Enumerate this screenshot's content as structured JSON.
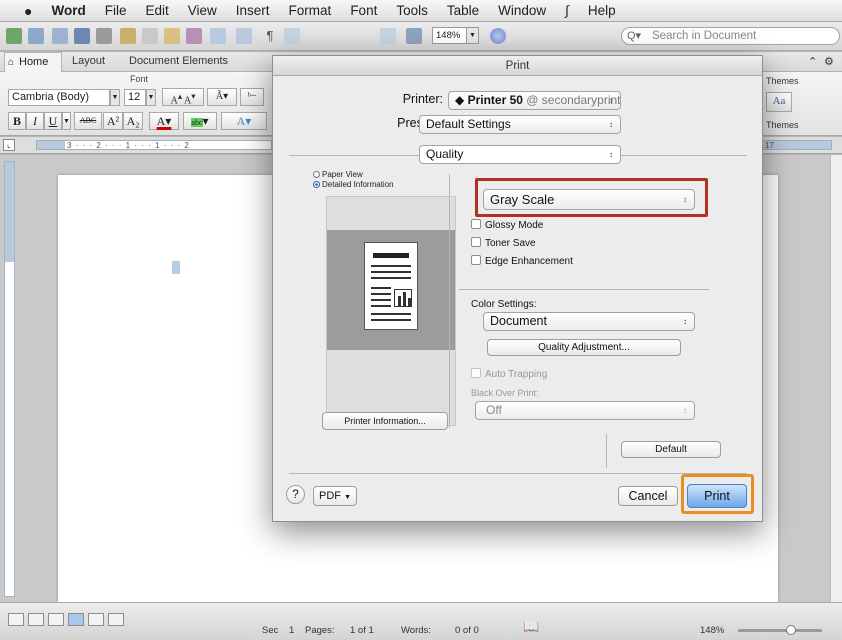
{
  "menubar": {
    "app_name": "Word",
    "items": [
      "File",
      "Edit",
      "View",
      "Insert",
      "Format",
      "Font",
      "Tools",
      "Table",
      "Window",
      "Help"
    ]
  },
  "toolbar": {
    "zoom_value": "148%",
    "search_placeholder": "Search in Document"
  },
  "ribbon": {
    "tabs": [
      "Home",
      "Layout",
      "Document Elements"
    ],
    "right_label": "Themes",
    "font_group_label": "Font",
    "font_name": "Cambria (Body)",
    "font_size": "12",
    "bold": "B",
    "italic": "I",
    "underline": "U",
    "strike": "ABC",
    "superscript": "A²",
    "subscript": "A₂",
    "themes_label": "Themes",
    "themes_preview": "Aa"
  },
  "ruler": {
    "ticks": "3 · · · 2 · · · 1 · · · 1 · · · 2",
    "right_tick": "17"
  },
  "status": {
    "section_label": "Sec",
    "section_value": "1",
    "pages_label": "Pages:",
    "pages_value": "1 of 1",
    "words_label": "Words:",
    "words_value": "0 of 0",
    "zoom": "148%"
  },
  "print_dialog": {
    "title": "Print",
    "printer_label": "Printer:",
    "printer_value": "Printer 50",
    "printer_server": "@ secondaryprints...",
    "presets_label": "Presets:",
    "presets_value": "Default Settings",
    "panel_value": "Quality",
    "view_options": [
      "Paper View",
      "Detailed Information"
    ],
    "selected_view": "Detailed Information",
    "printer_info_button": "Printer Information...",
    "color_mode": "Gray Scale",
    "checkboxes": [
      "Glossy Mode",
      "Toner Save",
      "Edge Enhancement"
    ],
    "color_settings_label": "Color Settings:",
    "color_settings_value": "Document",
    "quality_adjust_button": "Quality Adjustment...",
    "auto_trapping": "Auto Trapping",
    "black_over_print_label": "Black Over Print:",
    "black_over_print_value": "Off",
    "default_button": "Default",
    "help_button": "?",
    "pdf_button": "PDF",
    "cancel_button": "Cancel",
    "print_button": "Print"
  }
}
